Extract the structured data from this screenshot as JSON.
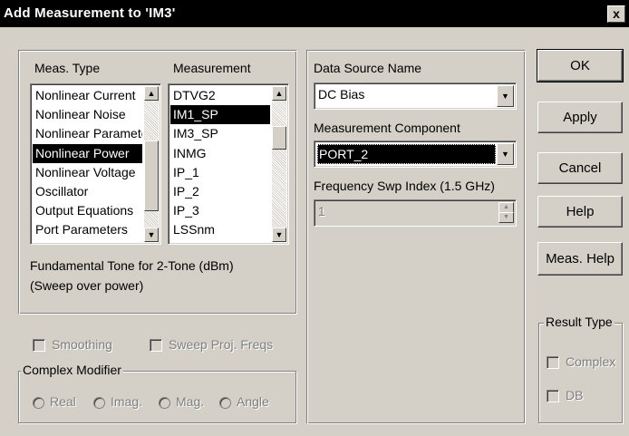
{
  "window": {
    "title": "Add Measurement to 'IM3'",
    "close_glyph": "x"
  },
  "meas_type": {
    "header": "Meas. Type",
    "items": [
      "Nonlinear Current",
      "Nonlinear Noise",
      "Nonlinear Paramete",
      "Nonlinear Power",
      "Nonlinear Voltage",
      "Oscillator",
      "Output Equations",
      "Port Parameters"
    ],
    "selected": "Nonlinear Power"
  },
  "measurement": {
    "header": "Measurement",
    "items": [
      "DTVG2",
      "IM1_SP",
      "IM3_SP",
      "INMG",
      "IP_1",
      "IP_2",
      "IP_3",
      "LSSnm"
    ],
    "selected": "IM1_SP"
  },
  "description": {
    "line1": "Fundamental Tone for 2-Tone (dBm)",
    "line2": "(Sweep over power)"
  },
  "data_source": {
    "label": "Data Source Name",
    "value": "DC Bias"
  },
  "meas_component": {
    "label": "Measurement Component",
    "value": "PORT_2"
  },
  "freq_index": {
    "label": "Frequency Swp Index (1.5 GHz)",
    "value": "1"
  },
  "options": {
    "smoothing": "Smoothing",
    "sweep_proj": "Sweep Proj. Freqs"
  },
  "complex_modifier": {
    "title": "Complex Modifier",
    "real": "Real",
    "imag": "Imag.",
    "mag": "Mag.",
    "angle": "Angle"
  },
  "result_type": {
    "title": "Result Type",
    "complex": "Complex",
    "db": "DB"
  },
  "buttons": {
    "ok": "OK",
    "apply": "Apply",
    "cancel": "Cancel",
    "help": "Help",
    "meas_help": "Meas. Help"
  },
  "glyphs": {
    "up": "▲",
    "down": "▼",
    "spin_up": "▲",
    "spin_down": "▼"
  },
  "colors": {
    "face": "#d4d0c8",
    "selection": "#000000",
    "disabled_text": "#808080"
  }
}
